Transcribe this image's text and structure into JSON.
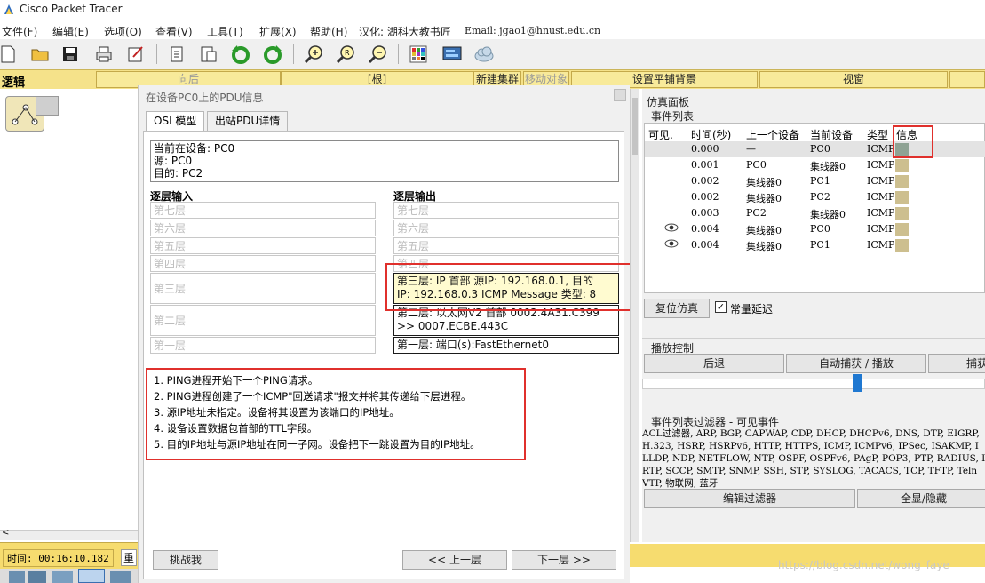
{
  "app": {
    "title": "Cisco Packet Tracer"
  },
  "menu": [
    "文件(F)",
    "编辑(E)",
    "选项(O)",
    "查看(V)",
    "工具(T)",
    "扩展(X)",
    "帮助(H)",
    "汉化: 湖科大教书匠",
    "Email: jgao1@hnust.edu.cn"
  ],
  "toolbar_icons": [
    "new-file-icon",
    "open-folder-icon",
    "save-icon",
    "print-icon",
    "activity-wizard-icon",
    "copy-icon",
    "paste-icon",
    "undo-icon",
    "redo-icon",
    "zoom-in-icon",
    "zoom-reset-icon",
    "zoom-out-icon",
    "palette-icon",
    "custom-device-icon",
    "cloud-icon"
  ],
  "logic_bar": {
    "mode": "逻辑",
    "back": "向后",
    "root": "[根]",
    "new_cluster": "新建集群",
    "move_object": "移动对象",
    "set_tile_bg": "设置平铺背景",
    "viewport": "视窗"
  },
  "status": {
    "time_label": "时间: 00:16:10.182",
    "reset_label": "重"
  },
  "pdu": {
    "title": "在设备PC0上的PDU信息",
    "tabs": [
      "OSI 模型",
      "出站PDU详情"
    ],
    "current_device": "当前在设备: PC0",
    "source": "源: PC0",
    "dest": "目的: PC2",
    "in_header": "逐层输入",
    "out_header": "逐层输出",
    "in_layers": [
      "第七层",
      "第六层",
      "第五层",
      "第四层",
      "第三层",
      "第二层",
      "第一层"
    ],
    "out_layers": [
      "第七层",
      "第六层",
      "第五层",
      "第四层"
    ],
    "out_l3_line1": "第三层:  IP 首部 源IP: 192.168.0.1, 目的",
    "out_l3_line2": "IP: 192.168.0.3 ICMP Message 类型: 8",
    "out_l2_line1": "第二层:  以太网V2 首部 0002.4A31.C399",
    "out_l2_line2": ">> 0007.ECBE.443C",
    "out_l1": "第一层:  端口(s):FastEthernet0",
    "steps": [
      "1. PING进程开始下一个PING请求。",
      "2. PING进程创建了一个ICMP\"回送请求\"报文并将其传递给下层进程。",
      "3. 源IP地址未指定。设备将其设置为该端口的IP地址。",
      "4. 设备设置数据包首部的TTL字段。",
      "5. 目的IP地址与源IP地址在同一子网。设备把下一跳设置为目的IP地址。"
    ],
    "challenge": "挑战我",
    "prev": "<< 上一层",
    "next": "下一层 >>"
  },
  "sim": {
    "panel_title": "仿真面板",
    "event_list": "事件列表",
    "columns": [
      "可见.",
      "时间(秒)",
      "上一个设备",
      "当前设备",
      "类型",
      "信息"
    ],
    "events": [
      {
        "time": "0.000",
        "last": "—",
        "at": "PC0",
        "type": "ICMP",
        "eye": false,
        "selected": true
      },
      {
        "time": "0.001",
        "last": "PC0",
        "at": "集线器0",
        "type": "ICMP",
        "eye": false,
        "selected": false
      },
      {
        "time": "0.002",
        "last": "集线器0",
        "at": "PC1",
        "type": "ICMP",
        "eye": false,
        "selected": false
      },
      {
        "time": "0.002",
        "last": "集线器0",
        "at": "PC2",
        "type": "ICMP",
        "eye": false,
        "selected": false
      },
      {
        "time": "0.003",
        "last": "PC2",
        "at": "集线器0",
        "type": "ICMP",
        "eye": false,
        "selected": false
      },
      {
        "time": "0.004",
        "last": "集线器0",
        "at": "PC0",
        "type": "ICMP",
        "eye": true,
        "selected": false
      },
      {
        "time": "0.004",
        "last": "集线器0",
        "at": "PC1",
        "type": "ICMP",
        "eye": true,
        "selected": false
      }
    ],
    "reset": "复位仿真",
    "constant_delay": "常量延迟",
    "constant_delay_checked": true,
    "playback": "播放控制",
    "back": "后退",
    "auto_capture": "自动捕获 / 播放",
    "capture": "捕获",
    "filter_title": "事件列表过滤器 - 可见事件",
    "filter_lines": [
      "ACL过滤器, ARP, BGP, CAPWAP, CDP, DHCP, DHCPv6, DNS, DTP, EIGRP,",
      "H.323, HSRP, HSRPv6, HTTP, HTTPS, ICMP, ICMPv6, IPSec, ISAKMP, I",
      "LLDP, NDP, NETFLOW, NTP, OSPF, OSPFv6, PAgP, POP3, PTP, RADIUS, I",
      "RTP, SCCP, SMTP, SNMP, SSH, STP, SYSLOG, TACACS, TCP, TFTP, Teln",
      "VTP, 物联网, 蓝牙"
    ],
    "edit_filter": "编辑过滤器",
    "show_hide": "全显/隐藏"
  },
  "watermark": "https://blog.csdn.net/wong_faye",
  "colors": {
    "highlight_red": "#e0302c",
    "logic_yellow": "#f6dc6f",
    "info_square": "#cdbf8f",
    "selected_info": "#8fa394"
  }
}
